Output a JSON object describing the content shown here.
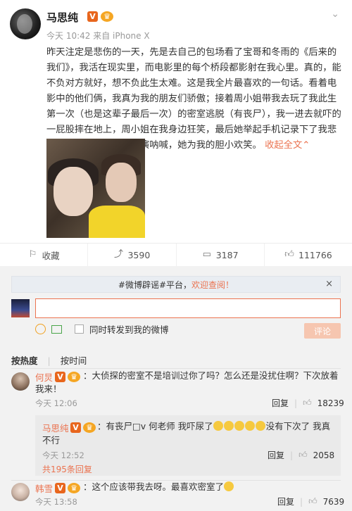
{
  "post": {
    "author": "马思纯",
    "badge_v": "V",
    "badge_vip": "♛",
    "meta": "今天 10:42 来自 iPhone X",
    "text": "昨天注定是悲伤的一天，先是去自己的包场看了宝哥和冬雨的《后来的我们》，我活在现实里，而电影里的每个桥段都影射在我心里。真的，能不负对方就好，想不负此生太难。这是我全片最喜欢的一句话。看着电影中的他们俩，我真为我的朋友们骄傲；接着周小姐带我去玩了我此生第一次（也是这辈子最后一次）的密室逃脱（有丧尸），我一进去就吓的一屁股摔在地上，周小姐在我身边狂笑，最后她举起手机记录下了我悲伤的时刻。我为她的表演呐喊，她为我的胆小欢笑。",
    "expand": "收起全文",
    "chevron": "⌄"
  },
  "actions": {
    "collect": "收藏",
    "repost": "3590",
    "comments": "3187",
    "likes": "111766"
  },
  "comment_box": {
    "notice_prefix": "#微博辟谣#平台，",
    "notice_link": "欢迎查阅！",
    "notice_close": "×",
    "repost_option": "同时转发到我的微博",
    "submit": "评论"
  },
  "sort": {
    "hot": "按热度",
    "time": "按时间"
  },
  "comments": [
    {
      "name": "何炅",
      "text": "：大侦探的密室不是培训过你了吗？怎么还是没扰住啊？下次放着",
      "text2": "我来！",
      "time": "今天 12:06",
      "reply": "回复",
      "likes": "18239"
    },
    {
      "name": "马思纯",
      "text_prefix": "：有丧尸□v 何老师 我吓尿了",
      "text_suffix": "没有下次了 我真",
      "text2": "不行",
      "time": "今天 12:52",
      "reply": "回复",
      "likes": "2058",
      "more": "共195条回复"
    },
    {
      "name": "韩雪",
      "text": "：这个应该带我去呀。最喜欢密室了",
      "time": "今天 13:58",
      "reply": "回复",
      "likes": "7639"
    }
  ]
}
